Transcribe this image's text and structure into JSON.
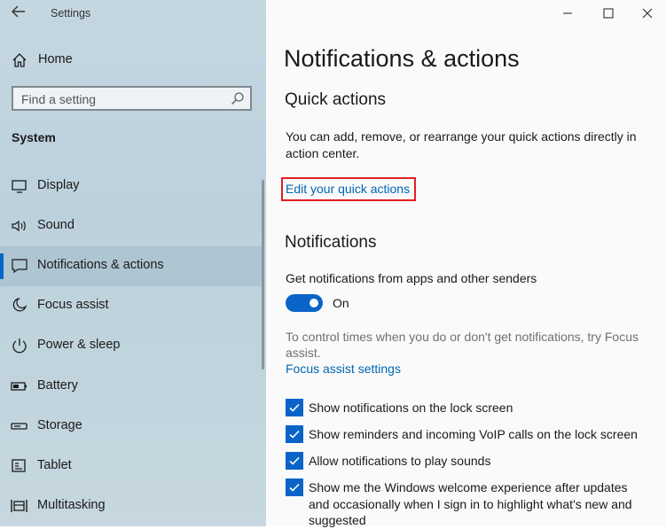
{
  "window": {
    "title": "Settings",
    "controls": [
      "minimize-icon",
      "maximize-icon",
      "close-icon"
    ]
  },
  "sidebar": {
    "home_label": "Home",
    "search_placeholder": "Find a setting",
    "section_label": "System",
    "items": [
      {
        "label": "Display",
        "icon": "display-icon",
        "selected": false
      },
      {
        "label": "Sound",
        "icon": "sound-icon",
        "selected": false
      },
      {
        "label": "Notifications & actions",
        "icon": "notifications-icon",
        "selected": true
      },
      {
        "label": "Focus assist",
        "icon": "moon-icon",
        "selected": false
      },
      {
        "label": "Power & sleep",
        "icon": "power-icon",
        "selected": false
      },
      {
        "label": "Battery",
        "icon": "battery-icon",
        "selected": false
      },
      {
        "label": "Storage",
        "icon": "storage-icon",
        "selected": false
      },
      {
        "label": "Tablet",
        "icon": "tablet-icon",
        "selected": false
      },
      {
        "label": "Multitasking",
        "icon": "multitasking-icon",
        "selected": false
      }
    ]
  },
  "main": {
    "page_title": "Notifications & actions",
    "quick_actions": {
      "heading": "Quick actions",
      "description_line1": "You can add, remove, or rearrange your quick actions directly in",
      "description_line2": "action center.",
      "edit_link": "Edit your quick actions"
    },
    "notifications": {
      "heading": "Notifications",
      "get_notifications_label": "Get notifications from apps and other senders",
      "toggle_state": "On",
      "focus_note_line1": "To control times when you do or don't get notifications, try Focus",
      "focus_note_line2": "assist.",
      "focus_link": "Focus assist settings",
      "checkboxes": [
        {
          "lines": [
            "Show notifications on the lock screen"
          ],
          "checked": true
        },
        {
          "lines": [
            "Show reminders and incoming VoIP calls on the lock screen"
          ],
          "checked": true
        },
        {
          "lines": [
            "Allow notifications to play sounds"
          ],
          "checked": true
        },
        {
          "lines": [
            "Show me the Windows welcome experience after updates",
            "and occasionally when I sign in to highlight what's new and",
            "suggested"
          ],
          "checked": true
        }
      ]
    }
  },
  "colors": {
    "accent": "#0a64c8",
    "link": "#0066b4",
    "highlight_box": "#e01e24",
    "sidebar_bg": "#c4d7e1"
  }
}
